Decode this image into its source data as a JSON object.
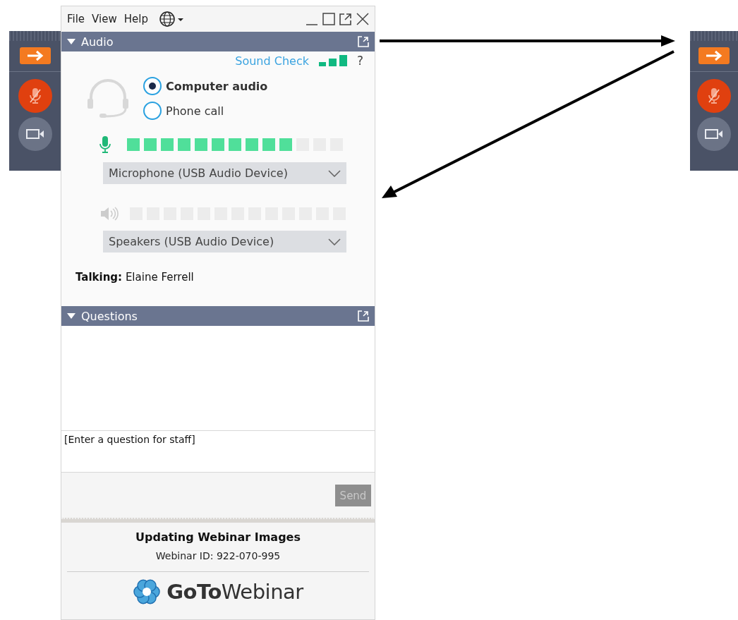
{
  "control_panels": [
    {
      "muted": true
    },
    {
      "muted": true
    }
  ],
  "window": {
    "menu": [
      "File",
      "View",
      "Help"
    ]
  },
  "audio": {
    "title": "Audio",
    "expanded": true,
    "sound_check": "Sound Check",
    "help": "?",
    "options": [
      {
        "label": "Computer audio",
        "selected": true
      },
      {
        "label": "Phone call",
        "selected": false
      }
    ],
    "microphone": {
      "level": 0.77,
      "device": "Microphone (USB Audio Device)"
    },
    "speaker": {
      "device": "Speakers (USB Audio Device)"
    },
    "talking_label": "Talking:",
    "talking_name": "Elaine Ferrell"
  },
  "questions": {
    "title": "Questions",
    "expanded": true,
    "placeholder": "[Enter a question for staff]",
    "send": "Send",
    "send_disabled": true
  },
  "footer": {
    "title": "Updating Webinar Images",
    "webinar_id": "Webinar ID: 922-070-995",
    "logo": "**GoTo**Webinar"
  }
}
